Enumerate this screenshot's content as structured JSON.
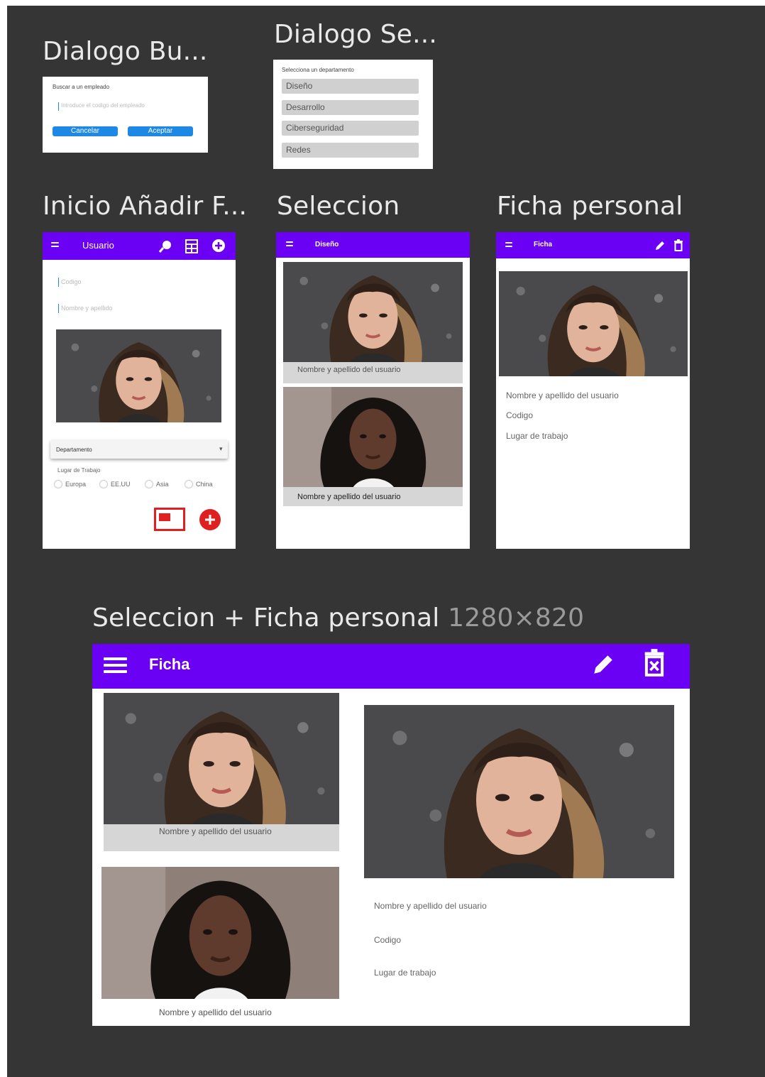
{
  "frames": {
    "dialogo_buscar": {
      "title": "Dialogo  Bu...",
      "heading": "Buscar a un empleado",
      "placeholder": "Introduce el codigo del empleado",
      "cancel_label": "Cancelar",
      "accept_label": "Aceptar"
    },
    "dialogo_seleccion": {
      "title": "Dialogo Se...",
      "heading": "Selecciona un departamento",
      "options": [
        "Diseño",
        "Desarrollo",
        "Ciberseguridad",
        "Redes"
      ]
    },
    "inicio": {
      "title": "Inicio Añadir F...",
      "appbar_title": "Usuario",
      "field_codigo": "Codigo",
      "field_nombre": "Nombre y apellido",
      "dropdown_label": "Departamento",
      "workplace_label": "Lugar de Trabajo",
      "radio_options": [
        "Europa",
        "EE.UU",
        "Asia",
        "China"
      ]
    },
    "seleccion": {
      "title": "Seleccion",
      "appbar_title": "Diseño",
      "cards": [
        "Nombre y apellido del usuario",
        "Nombre y apellido del usuario"
      ]
    },
    "ficha": {
      "title": "Ficha personal",
      "appbar_title": "Ficha",
      "info": [
        "Nombre y apellido del usuario",
        "Codigo",
        "Lugar de trabajo"
      ]
    },
    "combo": {
      "title": "Seleccion + Ficha personal",
      "size": "1280×820",
      "appbar_title": "Ficha",
      "cards": [
        "Nombre y apellido del usuario",
        "Nombre y apellido del usuario"
      ],
      "info": [
        "Nombre y apellido del usuario",
        "Codigo",
        "Lugar de trabajo"
      ]
    }
  },
  "colors": {
    "canvas": "#353535",
    "appbar": "#6a00f4",
    "button_blue": "#1e88e5",
    "fab_red": "#e02020"
  },
  "icons": [
    "menu-icon",
    "search-icon",
    "list-icon",
    "add-icon",
    "edit-icon",
    "delete-icon",
    "image-icon"
  ]
}
